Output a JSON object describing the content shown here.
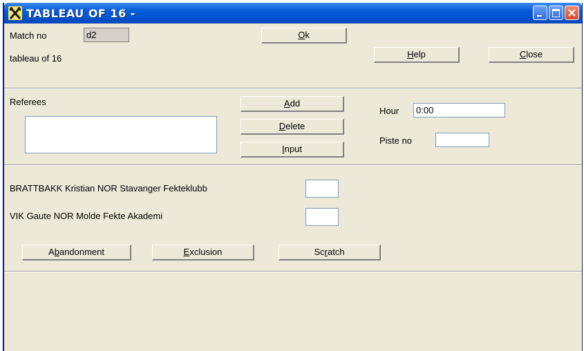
{
  "window": {
    "title": "TABLEAU OF 16 -",
    "app_icon": "fencing-crossed-swords-icon"
  },
  "header": {
    "match_no_label": "Match no",
    "match_no_value": "d2",
    "ok_label": "Ok",
    "ok_mnemonic": "O",
    "ok_rest": "k",
    "tableau_label": "tableau of 16",
    "help_label": "Help",
    "help_mnemonic": "H",
    "help_rest": "elp",
    "close_label": "Close",
    "close_mnemonic": "C",
    "close_rest": "lose"
  },
  "referees": {
    "label": "Referees",
    "add_mnemonic": "A",
    "add_rest": "dd",
    "delete_mnemonic": "D",
    "delete_rest": "elete",
    "input_mnemonic": "I",
    "input_rest": "nput",
    "hour_label": "Hour",
    "hour_value": "0:00",
    "piste_label": "Piste no",
    "piste_value": ""
  },
  "fencers": [
    {
      "name": "BRATTBAKK Kristian NOR Stavanger Fekteklubb",
      "score": ""
    },
    {
      "name": "VIK Gaute NOR Molde Fekte Akademi",
      "score": ""
    }
  ],
  "actions": {
    "abandonment_pre": "A",
    "abandonment_mnemonic": "b",
    "abandonment_rest": "andonment",
    "exclusion_mnemonic": "E",
    "exclusion_rest": "xclusion",
    "scratch_pre": "Sc",
    "scratch_mnemonic": "r",
    "scratch_rest": "atch"
  }
}
